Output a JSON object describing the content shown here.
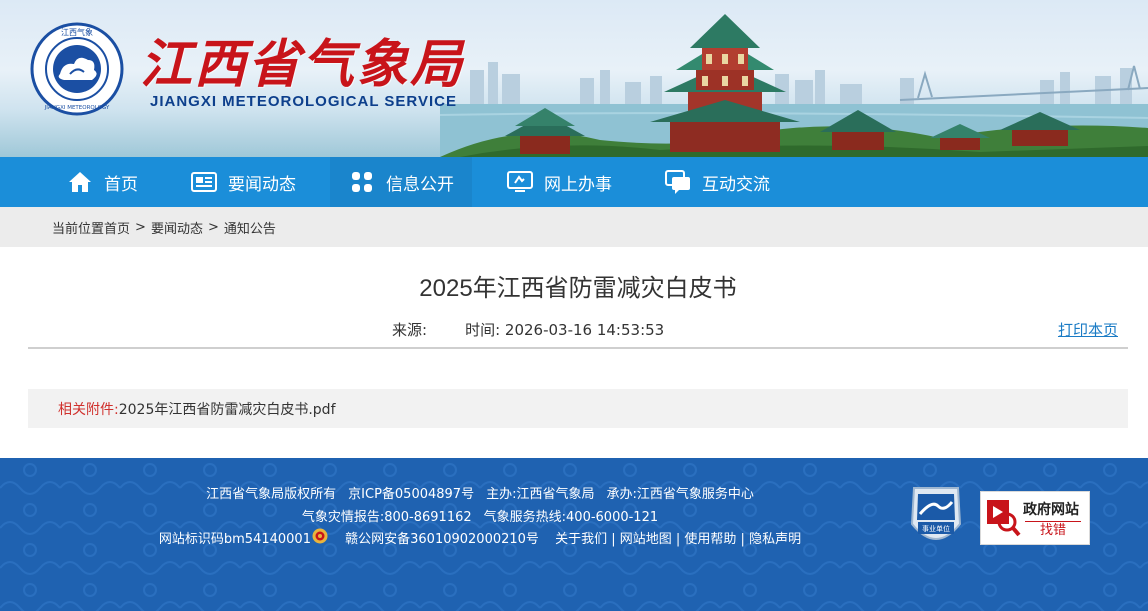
{
  "header": {
    "logo_cn": "江西省气象局",
    "logo_en": "JIANGXI METEOROLOGICAL SERVICE",
    "emblem_top_text": "江西气象",
    "emblem_bottom_text": "JIANGXI METEOROLOGY"
  },
  "nav": {
    "items": [
      {
        "label": "首页",
        "icon": "home-icon"
      },
      {
        "label": "要闻动态",
        "icon": "news-icon"
      },
      {
        "label": "信息公开",
        "icon": "grid-icon"
      },
      {
        "label": "网上办事",
        "icon": "monitor-icon"
      },
      {
        "label": "互动交流",
        "icon": "chat-icon"
      }
    ],
    "active_index": 2
  },
  "breadcrumb": {
    "prefix": "当前位置",
    "items": [
      "首页",
      "要闻动态",
      "通知公告"
    ],
    "separator": ">"
  },
  "article": {
    "title": "2025年江西省防雷减灾白皮书",
    "source_label": "来源:",
    "time_label": "时间:",
    "time_value": "2026-03-16 14:53:53",
    "print_label": "打印本页",
    "attachment_label": "相关附件:",
    "attachment_file": "2025年江西省防雷减灾白皮书.pdf"
  },
  "footer": {
    "copyright": "江西省气象局版权所有",
    "icp": "京ICP备05004897号",
    "sponsor": "主办:江西省气象局",
    "undertaker": "承办:江西省气象服务中心",
    "disaster_report": "气象灾情报告:800-8691162",
    "hotline": "气象服务热线:400-6000-121",
    "site_id": "网站标识码bm54140001",
    "police_record": "赣公网安备36010902000210号",
    "links": [
      "关于我们",
      "网站地图",
      "使用帮助",
      "隐私声明"
    ],
    "seal_label": "事业单位",
    "gov_error_line1": "政府网站",
    "gov_error_line2": "找错"
  },
  "colors": {
    "nav_bg": "#1b8ed9",
    "footer_bg": "#1f62b1",
    "logo_red": "#c8141a",
    "logo_blue": "#0d3f8c",
    "attachment_label_red": "#d0312d",
    "link_blue": "#1a7bc5"
  }
}
